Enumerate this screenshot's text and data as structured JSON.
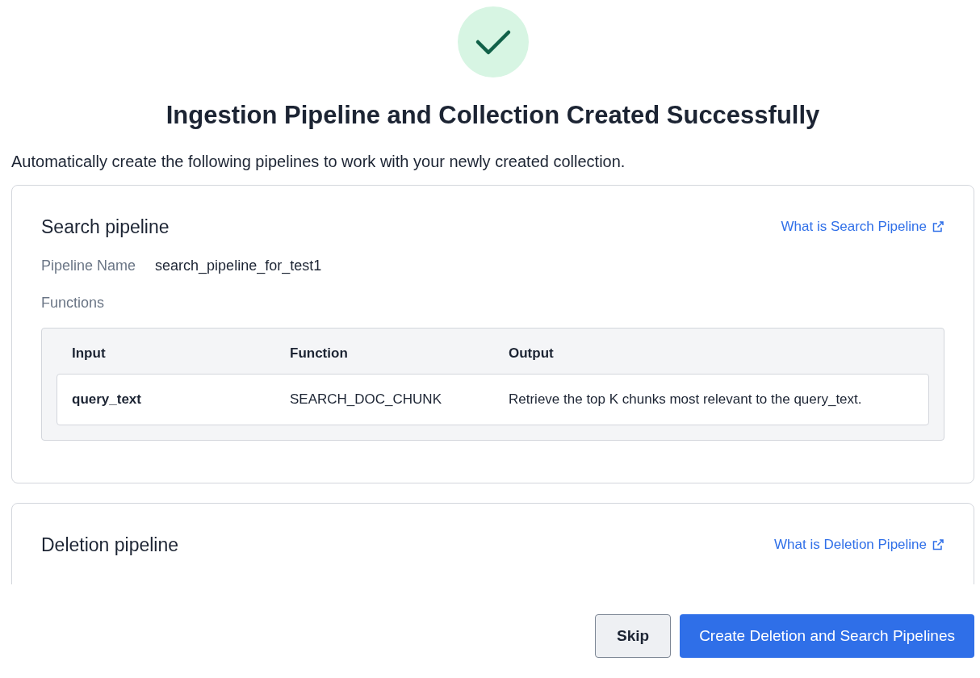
{
  "title": "Ingestion Pipeline and Collection Created Successfully",
  "description": "Automatically create the following pipelines to work with your newly created collection.",
  "pipelines": [
    {
      "kind": "search",
      "title": "Search pipeline",
      "help_link": "What is Search Pipeline",
      "name_label": "Pipeline Name",
      "name_value": "search_pipeline_for_test1",
      "functions_label": "Functions",
      "columns": [
        "Input",
        "Function",
        "Output"
      ],
      "rows": [
        {
          "input": "query_text",
          "function": "SEARCH_DOC_CHUNK",
          "output": "Retrieve the top K chunks most relevant to the query_text."
        }
      ]
    },
    {
      "kind": "deletion",
      "title": "Deletion pipeline",
      "help_link": "What is Deletion Pipeline"
    }
  ],
  "buttons": [
    {
      "label": "Skip",
      "kind": "secondary"
    },
    {
      "label": "Create Deletion and Search Pipelines",
      "kind": "primary"
    }
  ]
}
